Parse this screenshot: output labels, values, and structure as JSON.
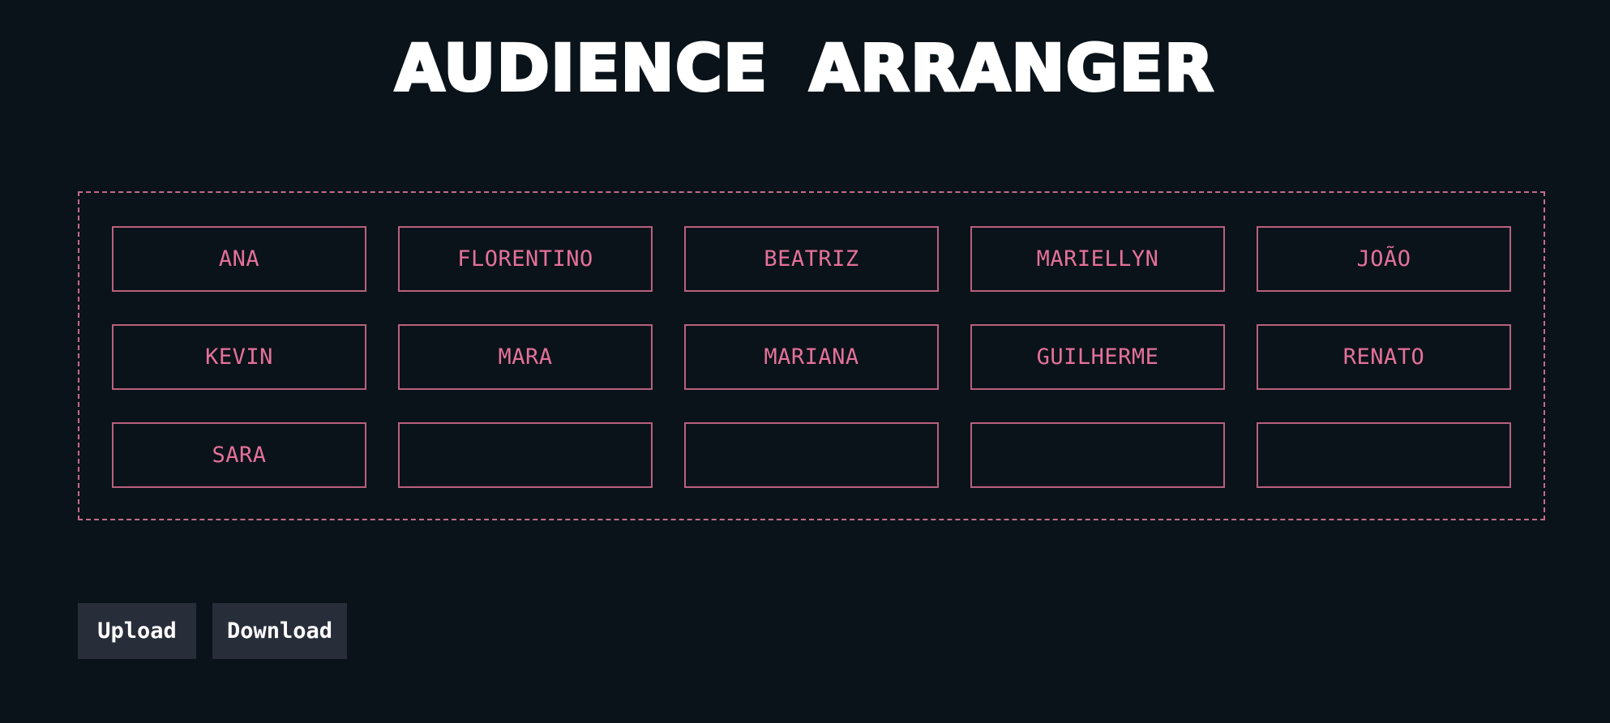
{
  "title": "AUDIENCE ARRANGER",
  "seats": [
    "ANA",
    "FLORENTINO",
    "BEATRIZ",
    "MARIELLYN",
    "JOÃO",
    "KEVIN",
    "MARA",
    "MARIANA",
    "GUILHERME",
    "RENATO",
    "SARA",
    "",
    "",
    "",
    ""
  ],
  "buttons": {
    "upload": "Upload",
    "download": "Download"
  },
  "colors": {
    "background": "#0a131a",
    "accent": "#e5719a",
    "border": "#b9607f",
    "button_bg": "#282d3a",
    "title": "#ffffff"
  }
}
